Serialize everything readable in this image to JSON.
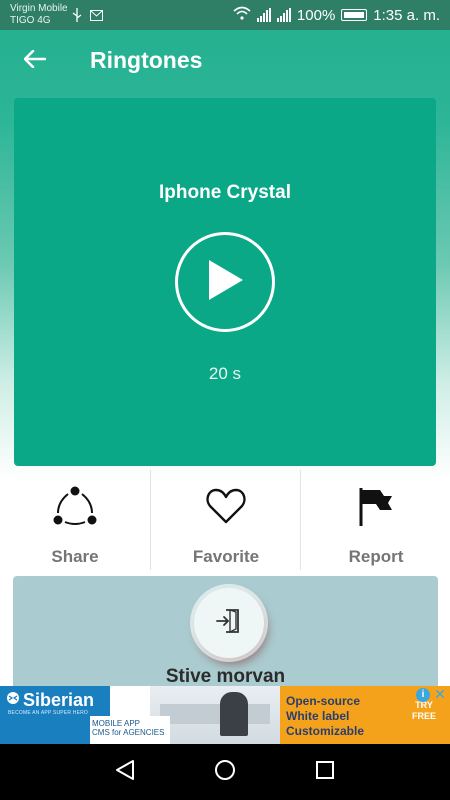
{
  "status_bar": {
    "carrier_line1": "Virgin Mobile",
    "carrier_line2": "TIGO 4G",
    "battery": "100%",
    "time": "1:35 a. m."
  },
  "app_bar": {
    "title": "Ringtones",
    "back_icon": "arrow-left-icon"
  },
  "player": {
    "ringtone_name": "Iphone Crystal",
    "duration": "20 s",
    "play_icon": "play-icon"
  },
  "actions": [
    {
      "label": "Share",
      "icon": "share-icon"
    },
    {
      "label": "Favorite",
      "icon": "heart-icon"
    },
    {
      "label": "Report",
      "icon": "flag-icon"
    }
  ],
  "author": {
    "name": "Stive morvan",
    "icon": "login-icon"
  },
  "ad": {
    "brand": "Siberian",
    "tagline": "BECOME AN APP SUPER HERO",
    "sub_line1": "MOBILE APP",
    "sub_line2": "CMS for AGENCIES",
    "line1": "Open-source",
    "line2": "White label",
    "line3": "Customizable",
    "cta_line1": "TRY",
    "cta_line2": "FREE"
  },
  "colors": {
    "status_bar": "#2f7f66",
    "primary": "#0aa886",
    "author_card": "#aaccd0",
    "label_gray": "#757575"
  }
}
